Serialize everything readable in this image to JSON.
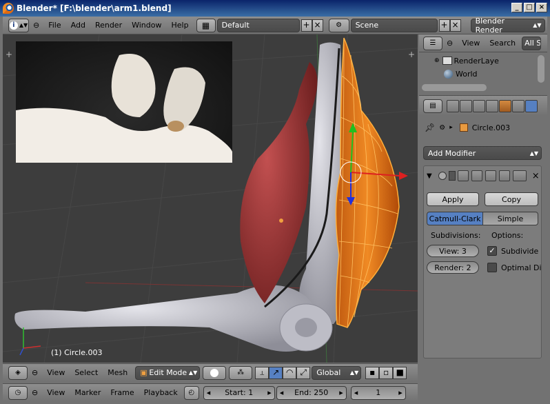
{
  "window": {
    "title": "Blender* [F:\\blender\\arm1.blend]"
  },
  "topbar": {
    "menus": [
      "File",
      "Add",
      "Render",
      "Window",
      "Help"
    ],
    "layout": "Default",
    "scene": "Scene",
    "engine": "Blender Render"
  },
  "viewport": {
    "object_label": "(1) Circle.003"
  },
  "view3d_header": {
    "menus": [
      "View",
      "Select",
      "Mesh"
    ],
    "mode": "Edit Mode",
    "orientation": "Global"
  },
  "timeline_header": {
    "menus": [
      "View",
      "Marker",
      "Frame",
      "Playback"
    ],
    "start": "Start: 1",
    "end": "End: 250",
    "current": "1"
  },
  "outliner": {
    "menus": [
      "View",
      "Search"
    ],
    "filter": "All S",
    "items": [
      "RenderLaye",
      "World"
    ]
  },
  "properties": {
    "object_name": "Circle.003",
    "add_modifier": "Add Modifier",
    "apply": "Apply",
    "copy": "Copy",
    "algo_active": "Catmull-Clark",
    "algo_other": "Simple",
    "subdivisions_label": "Subdivisions:",
    "options_label": "Options:",
    "view_field": "View: 3",
    "render_field": "Render: 2",
    "subdivide_uvs": "Subdivide",
    "optimal_display": "Optimal Di"
  },
  "colors": {
    "accent_orange": "#f08a24",
    "selected_blue": "#5680c2",
    "muscle_red": "#a63a3a"
  }
}
